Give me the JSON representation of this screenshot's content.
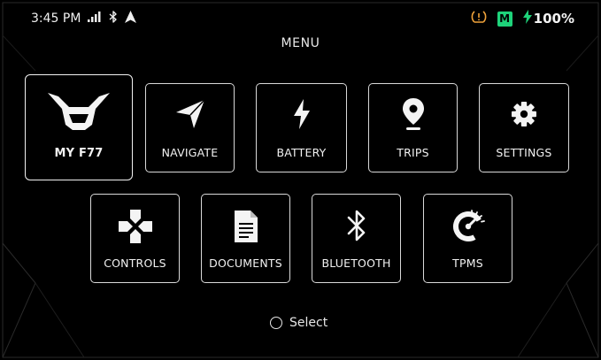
{
  "status_bar": {
    "time": "3:45 PM",
    "battery_percent": "100%",
    "drive_mode_badge": "M",
    "icons": [
      "signal-icon",
      "bluetooth-icon",
      "location-arrow-icon",
      "tire-pressure-warning-icon",
      "charging-bolt-icon"
    ],
    "colors": {
      "warning": "#f0a23a",
      "mode_badge": "#1ed37a",
      "charging": "#1ed37a"
    }
  },
  "menu": {
    "title": "MENU",
    "selected": "MY F77",
    "tiles_row1": [
      {
        "label": "MY F77",
        "icon": "bike-front-icon"
      },
      {
        "label": "NAVIGATE",
        "icon": "navigation-arrow-icon"
      },
      {
        "label": "BATTERY",
        "icon": "lightning-bolt-icon"
      },
      {
        "label": "TRIPS",
        "icon": "map-pin-icon"
      },
      {
        "label": "SETTINGS",
        "icon": "gear-icon"
      }
    ],
    "tiles_row2": [
      {
        "label": "CONTROLS",
        "icon": "dpad-icon"
      },
      {
        "label": "DOCUMENTS",
        "icon": "document-icon"
      },
      {
        "label": "BLUETOOTH",
        "icon": "bluetooth-icon"
      },
      {
        "label": "TPMS",
        "icon": "tpms-gauge-icon"
      }
    ]
  },
  "footer": {
    "select_label": "Select",
    "icon": "select-ring-icon"
  }
}
